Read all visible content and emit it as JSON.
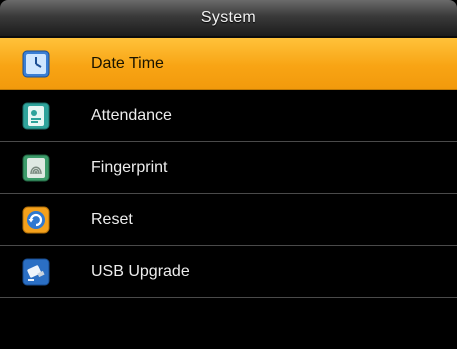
{
  "header": {
    "title": "System"
  },
  "menu": {
    "items": [
      {
        "label": "Date Time",
        "icon": "clock-calendar-icon",
        "selected": true
      },
      {
        "label": "Attendance",
        "icon": "attendance-icon",
        "selected": false
      },
      {
        "label": "Fingerprint",
        "icon": "fingerprint-icon",
        "selected": false
      },
      {
        "label": "Reset",
        "icon": "reset-icon",
        "selected": false
      },
      {
        "label": "USB Upgrade",
        "icon": "usb-upgrade-icon",
        "selected": false
      }
    ]
  },
  "colors": {
    "selection": "#f8a414",
    "background": "#000000",
    "text": "#ededed"
  }
}
